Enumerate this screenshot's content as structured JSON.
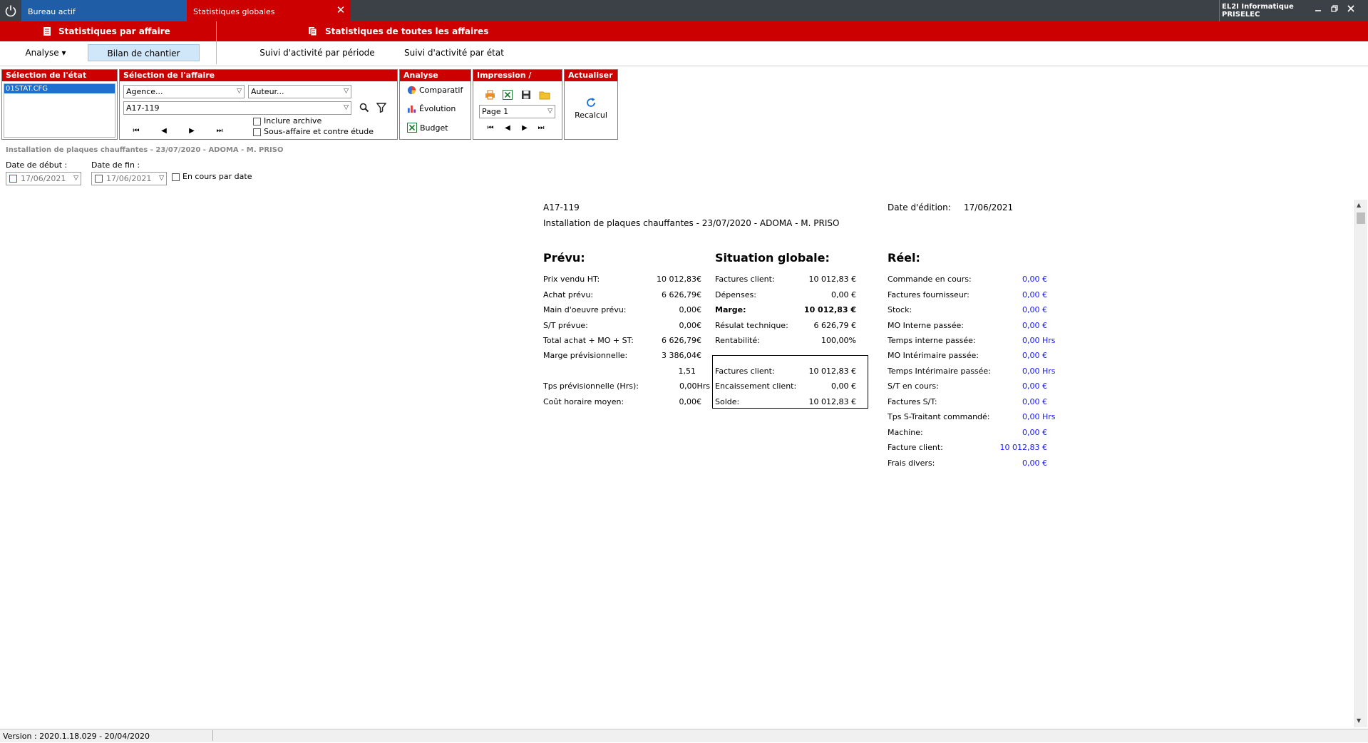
{
  "titlebar": {
    "tabs": [
      {
        "label": "Bureau actif",
        "active": false
      },
      {
        "label": "Statistiques globales",
        "active": true
      }
    ],
    "close_glyph": "✕",
    "company": "EL2I Informatique",
    "site": "PRISELEC",
    "window_buttons": [
      "minimize",
      "restore",
      "close"
    ]
  },
  "menu": {
    "left_title": "Statistiques par affaire",
    "right_title": "Statistiques de toutes les affaires"
  },
  "submenu": {
    "analyse": "Analyse ▾",
    "bilan": "Bilan de chantier",
    "suivi_periode": "Suivi d'activité par période",
    "suivi_etat": "Suivi d'activité par état"
  },
  "groups": {
    "selection_etat": {
      "title": "Sélection de l'état",
      "items": [
        "01STAT.CFG"
      ]
    },
    "selection_affaire": {
      "title": "Sélection de l'affaire",
      "agence": "Agence...",
      "auteur": "Auteur...",
      "affaire": "A17-119",
      "inclure_archive": "Inclure archive",
      "sous_affaire": "Sous-affaire et contre étude"
    },
    "analyse": {
      "title": "Analyse",
      "items": [
        "Comparatif",
        "Évolution",
        "Budget"
      ]
    },
    "impression": {
      "title": "Impression / Export",
      "page": "Page 1"
    },
    "actualiser": {
      "title": "Actualiser",
      "button": "Recalcul"
    }
  },
  "affaire_caption": "Installation de plaques chauffantes - 23/07/2020 - ADOMA - M. PRISO",
  "dates": {
    "debut_label": "Date de début :",
    "debut_value": "17/06/2021",
    "fin_label": "Date de fin :",
    "fin_value": "17/06/2021",
    "en_cours": "En cours par date"
  },
  "report": {
    "code": "A17-119",
    "edition_label": "Date d'édition:",
    "edition_date": "17/06/2021",
    "description": "Installation de plaques chauffantes - 23/07/2020 - ADOMA - M. PRISO",
    "prevu": {
      "title": "Prévu:",
      "rows": [
        {
          "label": "Prix vendu HT:",
          "value": "10 012,83€"
        },
        {
          "label": "Achat prévu:",
          "value": "6 626,79€"
        },
        {
          "label": "Main d'oeuvre prévu:",
          "value": "0,00€"
        },
        {
          "label": "S/T prévue:",
          "value": "0,00€"
        },
        {
          "label": "Total achat + MO + ST:",
          "value": "6 626,79€"
        },
        {
          "label": "Marge prévisionnelle:",
          "value": "3 386,04€"
        },
        {
          "label": "",
          "value": "1,51"
        },
        {
          "label": "Tps prévisionnelle (Hrs):",
          "value": "0,00Hrs"
        },
        {
          "label": "Coût horaire moyen:",
          "value": "0,00€"
        }
      ]
    },
    "globale": {
      "title": "Situation globale:",
      "rows": [
        {
          "label": "Factures client:",
          "value": "10 012,83 €",
          "bold": false
        },
        {
          "label": "Dépenses:",
          "value": "0,00 €",
          "bold": false
        },
        {
          "label": "Marge:",
          "value": "10 012,83 €",
          "bold": true
        },
        {
          "label": "Résulat technique:",
          "value": "6 626,79 €",
          "bold": false
        },
        {
          "label": "Rentabilité:",
          "value": "100,00%",
          "bold": false
        }
      ],
      "box": [
        {
          "label": "Factures client:",
          "value": "10 012,83 €"
        },
        {
          "label": "Encaissement client:",
          "value": "0,00 €"
        },
        {
          "label": "Solde:",
          "value": "10 012,83 €"
        }
      ]
    },
    "reel": {
      "title": "Réel:",
      "rows": [
        {
          "label": "Commande en cours:",
          "value": "0,00 €"
        },
        {
          "label": "Factures fournisseur:",
          "value": "0,00 €"
        },
        {
          "label": "Stock:",
          "value": "0,00 €"
        },
        {
          "label": "MO Interne passée:",
          "value": "0,00 €"
        },
        {
          "label": "Temps interne passée:",
          "value": "0,00 Hrs"
        },
        {
          "label": "MO Intérimaire passée:",
          "value": "0,00 €"
        },
        {
          "label": "Temps Intérimaire passée:",
          "value": "0,00 Hrs"
        },
        {
          "label": "S/T en cours:",
          "value": "0,00 €"
        },
        {
          "label": "Factures S/T:",
          "value": "0,00 €"
        },
        {
          "label": "Tps S-Traitant commandé:",
          "value": "0,00 Hrs"
        },
        {
          "label": "Machine:",
          "value": "0,00 €"
        },
        {
          "label": "Facture client:",
          "value": "10 012,83 €"
        },
        {
          "label": "Frais divers:",
          "value": "0,00 €"
        }
      ]
    }
  },
  "status": {
    "version": "Version : 2020.1.18.029 - 20/04/2020"
  },
  "colors": {
    "accent_red": "#cc0000",
    "tab_blue": "#1f5ea6",
    "titlebar": "#3c4148",
    "value_blue": "#1a1aff"
  }
}
